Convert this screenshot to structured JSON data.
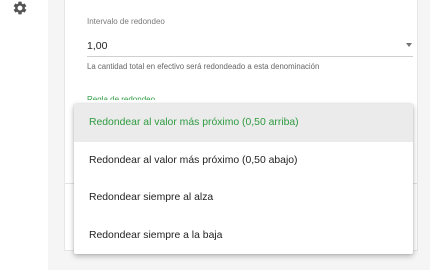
{
  "sidebar": {
    "icon": "gear-icon"
  },
  "form": {
    "rounding_interval": {
      "label": "Intervalo de redondeo",
      "value": "1,00",
      "helper": "La cantidad total en efectivo será redondeado a esta denominación"
    },
    "rounding_mode": {
      "label": "Regla de redondeo"
    }
  },
  "dropdown": {
    "options": [
      {
        "label": "Redondear al valor más próximo (0,50 arriba)",
        "selected": true
      },
      {
        "label": "Redondear al valor más próximo (0,50 abajo)",
        "selected": false
      },
      {
        "label": "Redondear siempre al alza",
        "selected": false
      },
      {
        "label": "Redondear siempre a la baja",
        "selected": false
      }
    ]
  },
  "colors": {
    "accent": "#2e9b40",
    "icon": "#555555"
  }
}
